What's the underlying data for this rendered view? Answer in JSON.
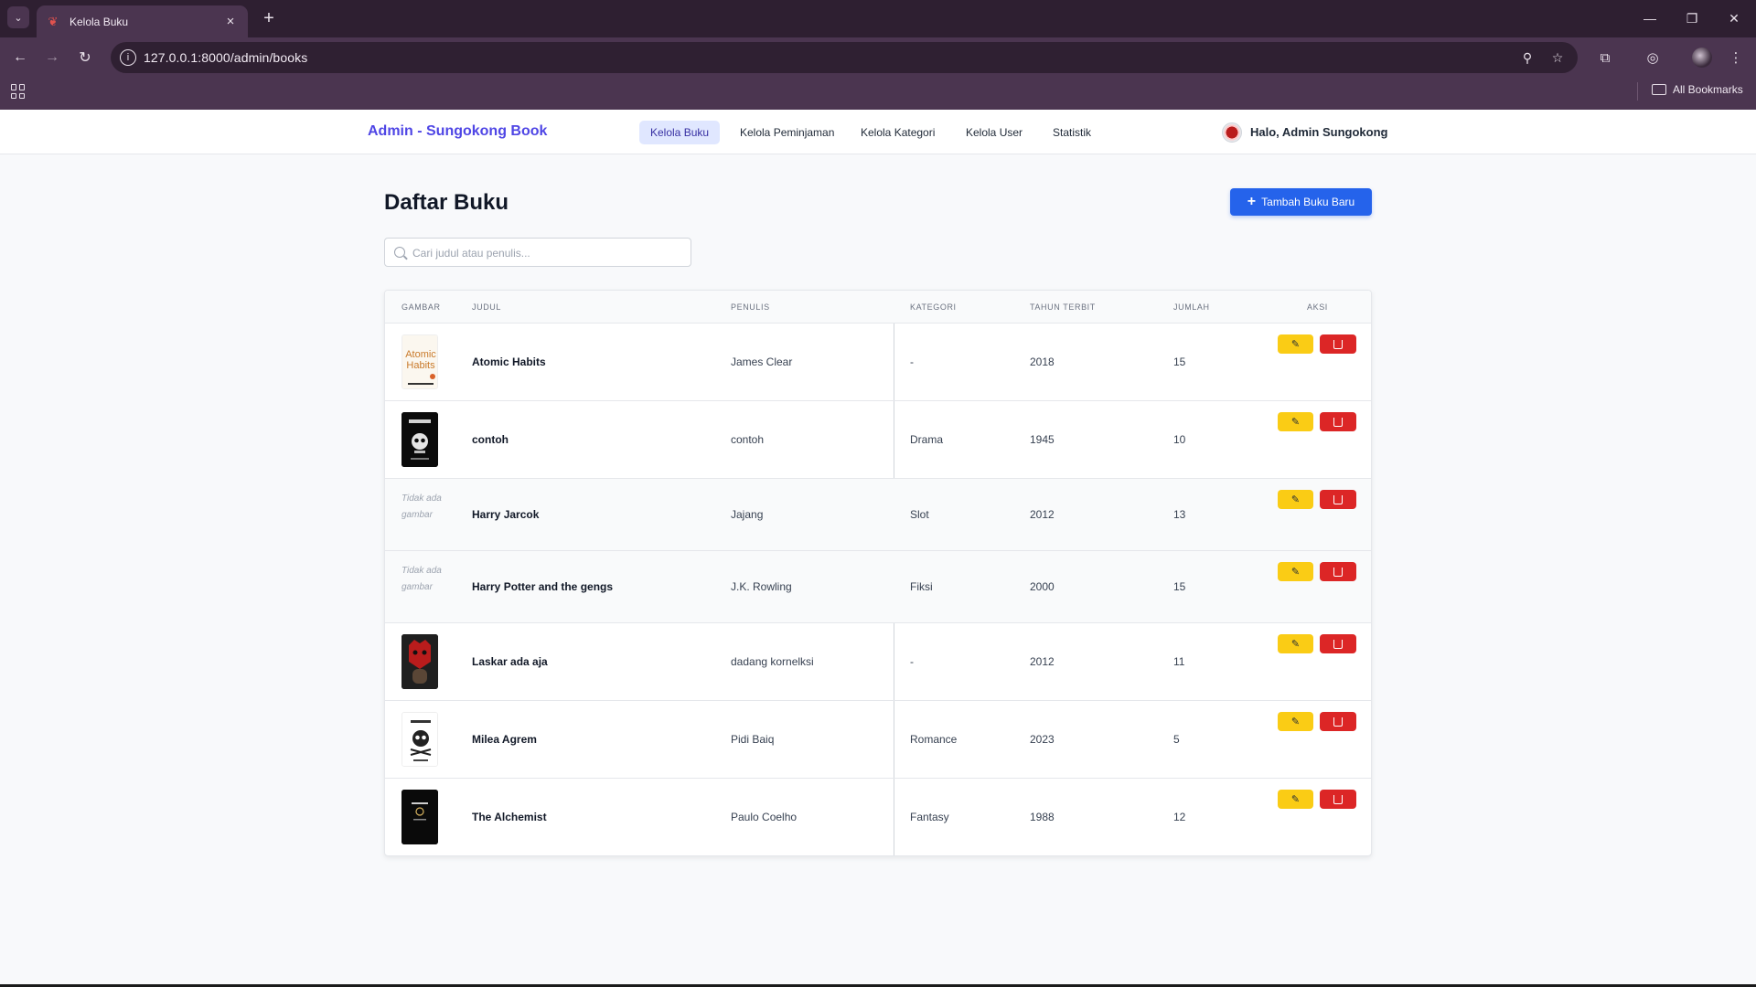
{
  "browser": {
    "tab_title": "Kelola Buku",
    "url": "127.0.0.1:8000/admin/books",
    "bookmarks_label": "All Bookmarks",
    "accent": "#4b3550"
  },
  "nav": {
    "brand": "Admin - Sungokong Book",
    "links": [
      "Kelola Buku",
      "Kelola Peminjaman",
      "Kelola Kategori",
      "Kelola User",
      "Statistik"
    ],
    "active": "Kelola Buku",
    "user_greeting": "Halo, Admin Sungokong"
  },
  "page": {
    "title": "Daftar Buku",
    "add_button": "Tambah Buku Baru",
    "search_placeholder": "Cari judul atau penulis..."
  },
  "table": {
    "headers": [
      "GAMBAR",
      "JUDUL",
      "PENULIS",
      "KATEGORI",
      "TAHUN TERBIT",
      "JUMLAH",
      "AKSI"
    ],
    "no_image_text": "Tidak ada gambar",
    "rows": [
      {
        "cover": "atomic-habits-cover",
        "cover_text": "Atomic Habits",
        "title": "Atomic Habits",
        "author": "James Clear",
        "category": "-",
        "year": "2018",
        "qty": "15"
      },
      {
        "cover": "dark-skull-cover",
        "title": "contoh",
        "author": "contoh",
        "category": "Drama",
        "year": "1945",
        "qty": "10"
      },
      {
        "cover": null,
        "title": "Harry Jarcok",
        "author": "Jajang",
        "category": "Slot",
        "year": "2012",
        "qty": "13"
      },
      {
        "cover": null,
        "title": "Harry Potter and the gengs",
        "author": "J.K. Rowling",
        "category": "Fiksi",
        "year": "2000",
        "qty": "15"
      },
      {
        "cover": "red-mask-cover",
        "title": "Laskar ada aja",
        "author": "dadang kornelksi",
        "category": "-",
        "year": "2012",
        "qty": "11"
      },
      {
        "cover": "white-skull-cover",
        "title": "Milea Agrem",
        "author": "Pidi Baiq",
        "category": "Romance",
        "year": "2023",
        "qty": "5"
      },
      {
        "cover": "alchemist-dark-cover",
        "title": "The Alchemist",
        "author": "Paulo Coelho",
        "category": "Fantasy",
        "year": "1988",
        "qty": "12"
      }
    ]
  },
  "colors": {
    "brand": "#4f46e5",
    "primary_button": "#2563eb",
    "edit_button": "#facc15",
    "delete_button": "#dc2626"
  }
}
